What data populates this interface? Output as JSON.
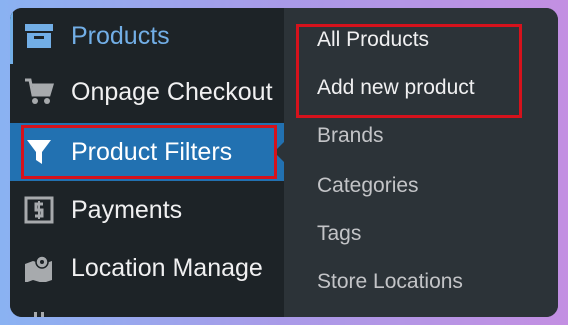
{
  "sidebar": {
    "items": [
      {
        "label": "Products",
        "icon": "archive-icon"
      },
      {
        "label": "Onpage Checkout",
        "icon": "cart-icon"
      },
      {
        "label": "Product Filters",
        "icon": "filter-icon"
      },
      {
        "label": "Payments",
        "icon": "dollar-icon"
      },
      {
        "label": "Location Manage",
        "icon": "map-icon"
      }
    ]
  },
  "submenu": {
    "items": [
      {
        "label": "All Products"
      },
      {
        "label": "Add new product"
      },
      {
        "label": "Brands"
      },
      {
        "label": "Categories"
      },
      {
        "label": "Tags"
      },
      {
        "label": "Store Locations"
      }
    ]
  },
  "colors": {
    "sidebar_bg": "#1d2327",
    "submenu_bg": "#2c3338",
    "active_bg": "#2271b1",
    "current_text": "#72aee6",
    "highlight": "#d6121c"
  }
}
